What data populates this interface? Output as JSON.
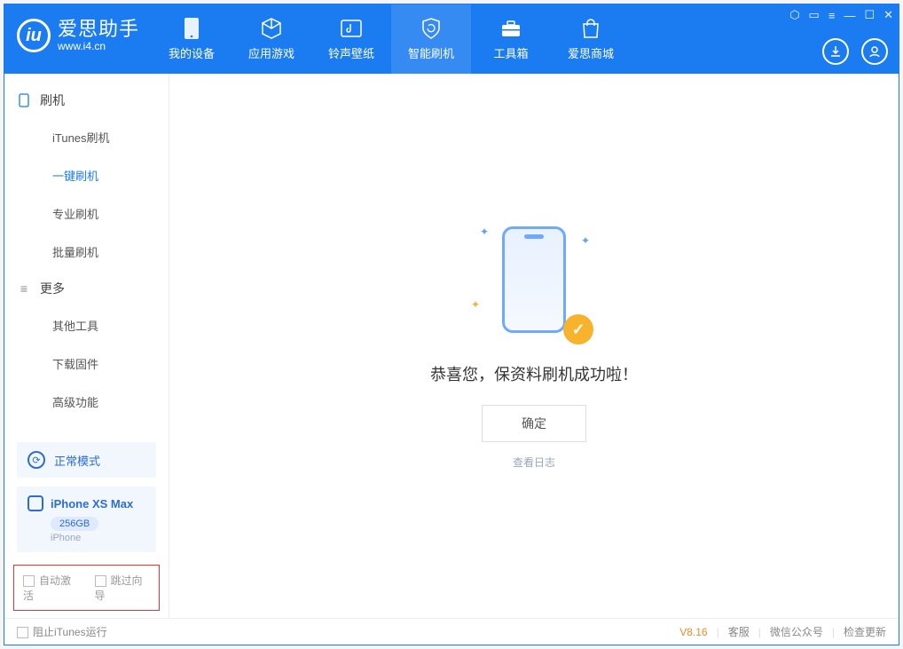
{
  "app": {
    "title": "爱思助手",
    "site": "www.i4.cn"
  },
  "tabs": {
    "device": "我的设备",
    "apps": "应用游戏",
    "rings": "铃声壁纸",
    "flash": "智能刷机",
    "toolbox": "工具箱",
    "store": "爱思商城"
  },
  "sidebar": {
    "sec_flash": "刷机",
    "itunes": "iTunes刷机",
    "oneclick": "一键刷机",
    "pro": "专业刷机",
    "batch": "批量刷机",
    "sec_more": "更多",
    "other": "其他工具",
    "firmware": "下载固件",
    "advanced": "高级功能",
    "mode": "正常模式",
    "device_name": "iPhone XS Max",
    "capacity": "256GB",
    "device_type": "iPhone",
    "auto_activate": "自动激活",
    "skip_wizard": "跳过向导"
  },
  "main": {
    "success_msg": "恭喜您，保资料刷机成功啦！",
    "ok": "确定",
    "view_log": "查看日志"
  },
  "footer": {
    "block_itunes": "阻止iTunes运行",
    "version": "V8.16",
    "service": "客服",
    "wechat": "微信公众号",
    "update": "检查更新"
  }
}
